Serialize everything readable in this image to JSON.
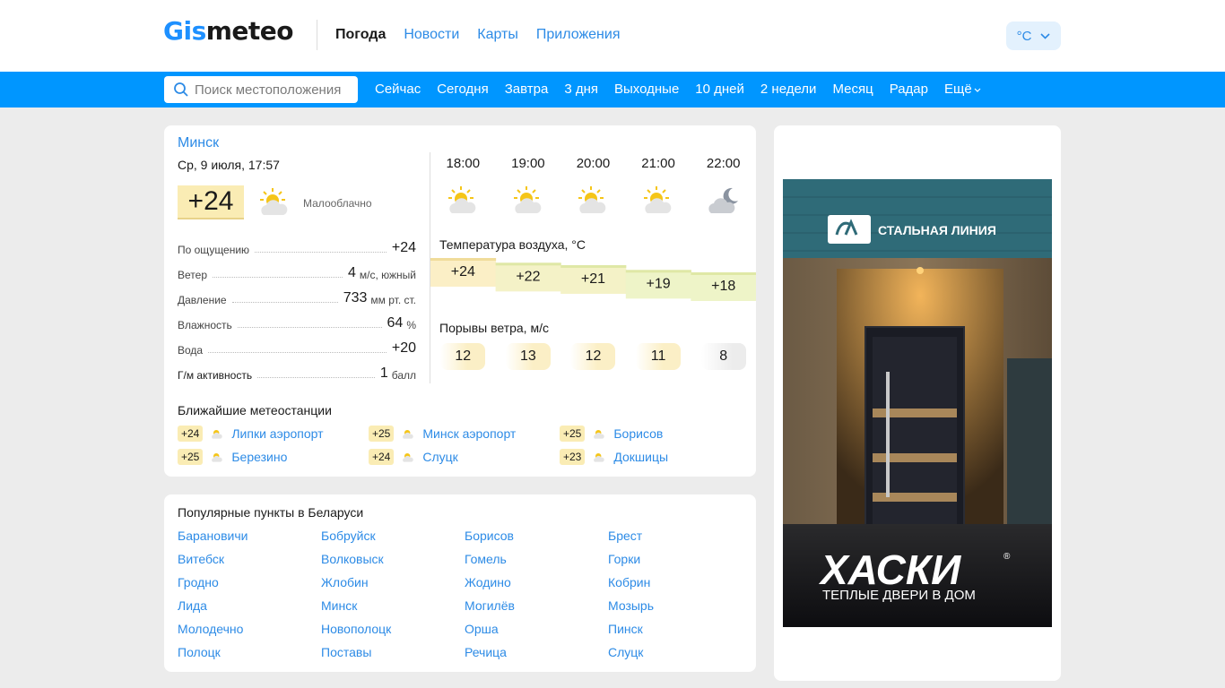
{
  "header": {
    "logo_part1": "Gis",
    "logo_part2": "meteo",
    "nav": [
      "Погода",
      "Новости",
      "Карты",
      "Приложения"
    ],
    "unit": "°C"
  },
  "subnav": {
    "search_placeholder": "Поиск местоположения",
    "items": [
      "Сейчас",
      "Сегодня",
      "Завтра",
      "3 дня",
      "Выходные",
      "10 дней",
      "2 недели",
      "Месяц",
      "Радар",
      "Ещё"
    ]
  },
  "current": {
    "city": "Минск",
    "datetime": "Ср, 9 июля, 17:57",
    "temp": "+24",
    "description": "Малооблачно",
    "icon": "partly-cloudy-day-icon",
    "params": [
      {
        "label": "По ощущению",
        "value": "+24",
        "unit": ""
      },
      {
        "label": "Ветер",
        "value": "4",
        "unit": "м/c, южный"
      },
      {
        "label": "Давление",
        "value": "733",
        "unit": "мм рт. ст."
      },
      {
        "label": "Влажность",
        "value": "64",
        "unit": "%"
      },
      {
        "label": "Вода",
        "value": "+20",
        "unit": ""
      },
      {
        "label": "Г/м активность",
        "value": "1",
        "unit": "балл"
      }
    ]
  },
  "hourly": {
    "times": [
      "18:00",
      "19:00",
      "20:00",
      "21:00",
      "22:00"
    ],
    "icons": [
      "partly-cloudy-day-icon",
      "partly-cloudy-day-icon",
      "partly-cloudy-day-icon",
      "partly-cloudy-day-icon",
      "partly-cloudy-night-icon"
    ],
    "temp_title": "Температура воздуха, °C",
    "temps": [
      "+24",
      "+22",
      "+21",
      "+19",
      "+18"
    ],
    "gust_title": "Порывы ветра, м/с",
    "gusts": [
      "12",
      "13",
      "12",
      "11",
      "8"
    ]
  },
  "stations": {
    "title": "Ближайшие метеостанции",
    "items": [
      {
        "temp": "+24",
        "name": "Липки аэропорт"
      },
      {
        "temp": "+25",
        "name": "Минск аэропорт"
      },
      {
        "temp": "+25",
        "name": "Борисов"
      },
      {
        "temp": "+25",
        "name": "Березино"
      },
      {
        "temp": "+24",
        "name": "Слуцк"
      },
      {
        "temp": "+23",
        "name": "Докшицы"
      }
    ]
  },
  "popular": {
    "title": "Популярные пункты в Беларуси",
    "cities": [
      "Барановичи",
      "Бобруйск",
      "Борисов",
      "Брест",
      "Витебск",
      "Волковыск",
      "Гомель",
      "Горки",
      "Гродно",
      "Жлобин",
      "Жодино",
      "Кобрин",
      "Лида",
      "Минск",
      "Могилёв",
      "Мозырь",
      "Молодечно",
      "Новополоцк",
      "Орша",
      "Пинск",
      "Полоцк",
      "Поставы",
      "Речица",
      "Слуцк"
    ]
  },
  "ad": {
    "brand": "СТАЛЬНАЯ ЛИНИЯ",
    "headline": "ХАСКИ",
    "tagline": "ТЕПЛЫЕ ДВЕРИ В ДОМ",
    "registered": "®"
  },
  "colors": {
    "accent": "#0096ff",
    "link": "#2d8be6",
    "temp_badge": "#faecb4"
  }
}
